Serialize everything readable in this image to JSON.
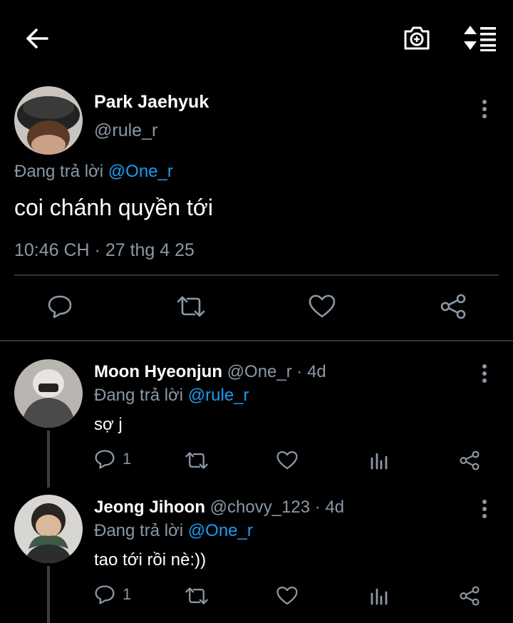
{
  "header": {
    "back_icon": "arrow-left-icon",
    "camera_icon": "camera-add-icon",
    "sort_icon": "sort-lines-icon"
  },
  "main_tweet": {
    "display_name": "Park Jaehyuk",
    "handle": "@rule_r",
    "replying_prefix": "Đang trả lời",
    "replying_to": "@One_r",
    "text": "coi chánh quyền tới",
    "timestamp": "10:46 CH · 27 thg 4 25"
  },
  "replies": [
    {
      "display_name": "Moon Hyeonjun",
      "handle": "@One_r",
      "age": "· 4d",
      "replying_prefix": "Đang trả lời",
      "replying_to": "@rule_r",
      "text": "sợ j",
      "reply_count": "1"
    },
    {
      "display_name": "Jeong Jihoon",
      "handle": "@chovy_123",
      "age": "· 4d",
      "replying_prefix": "Đang trả lời",
      "replying_to": "@One_r",
      "text": "tao tới rồi nè:))",
      "reply_count": "1"
    }
  ],
  "colors": {
    "background": "#000000",
    "accent": "#1d9bf0",
    "secondary_text": "#8b98a5",
    "divider": "#2f3336"
  }
}
